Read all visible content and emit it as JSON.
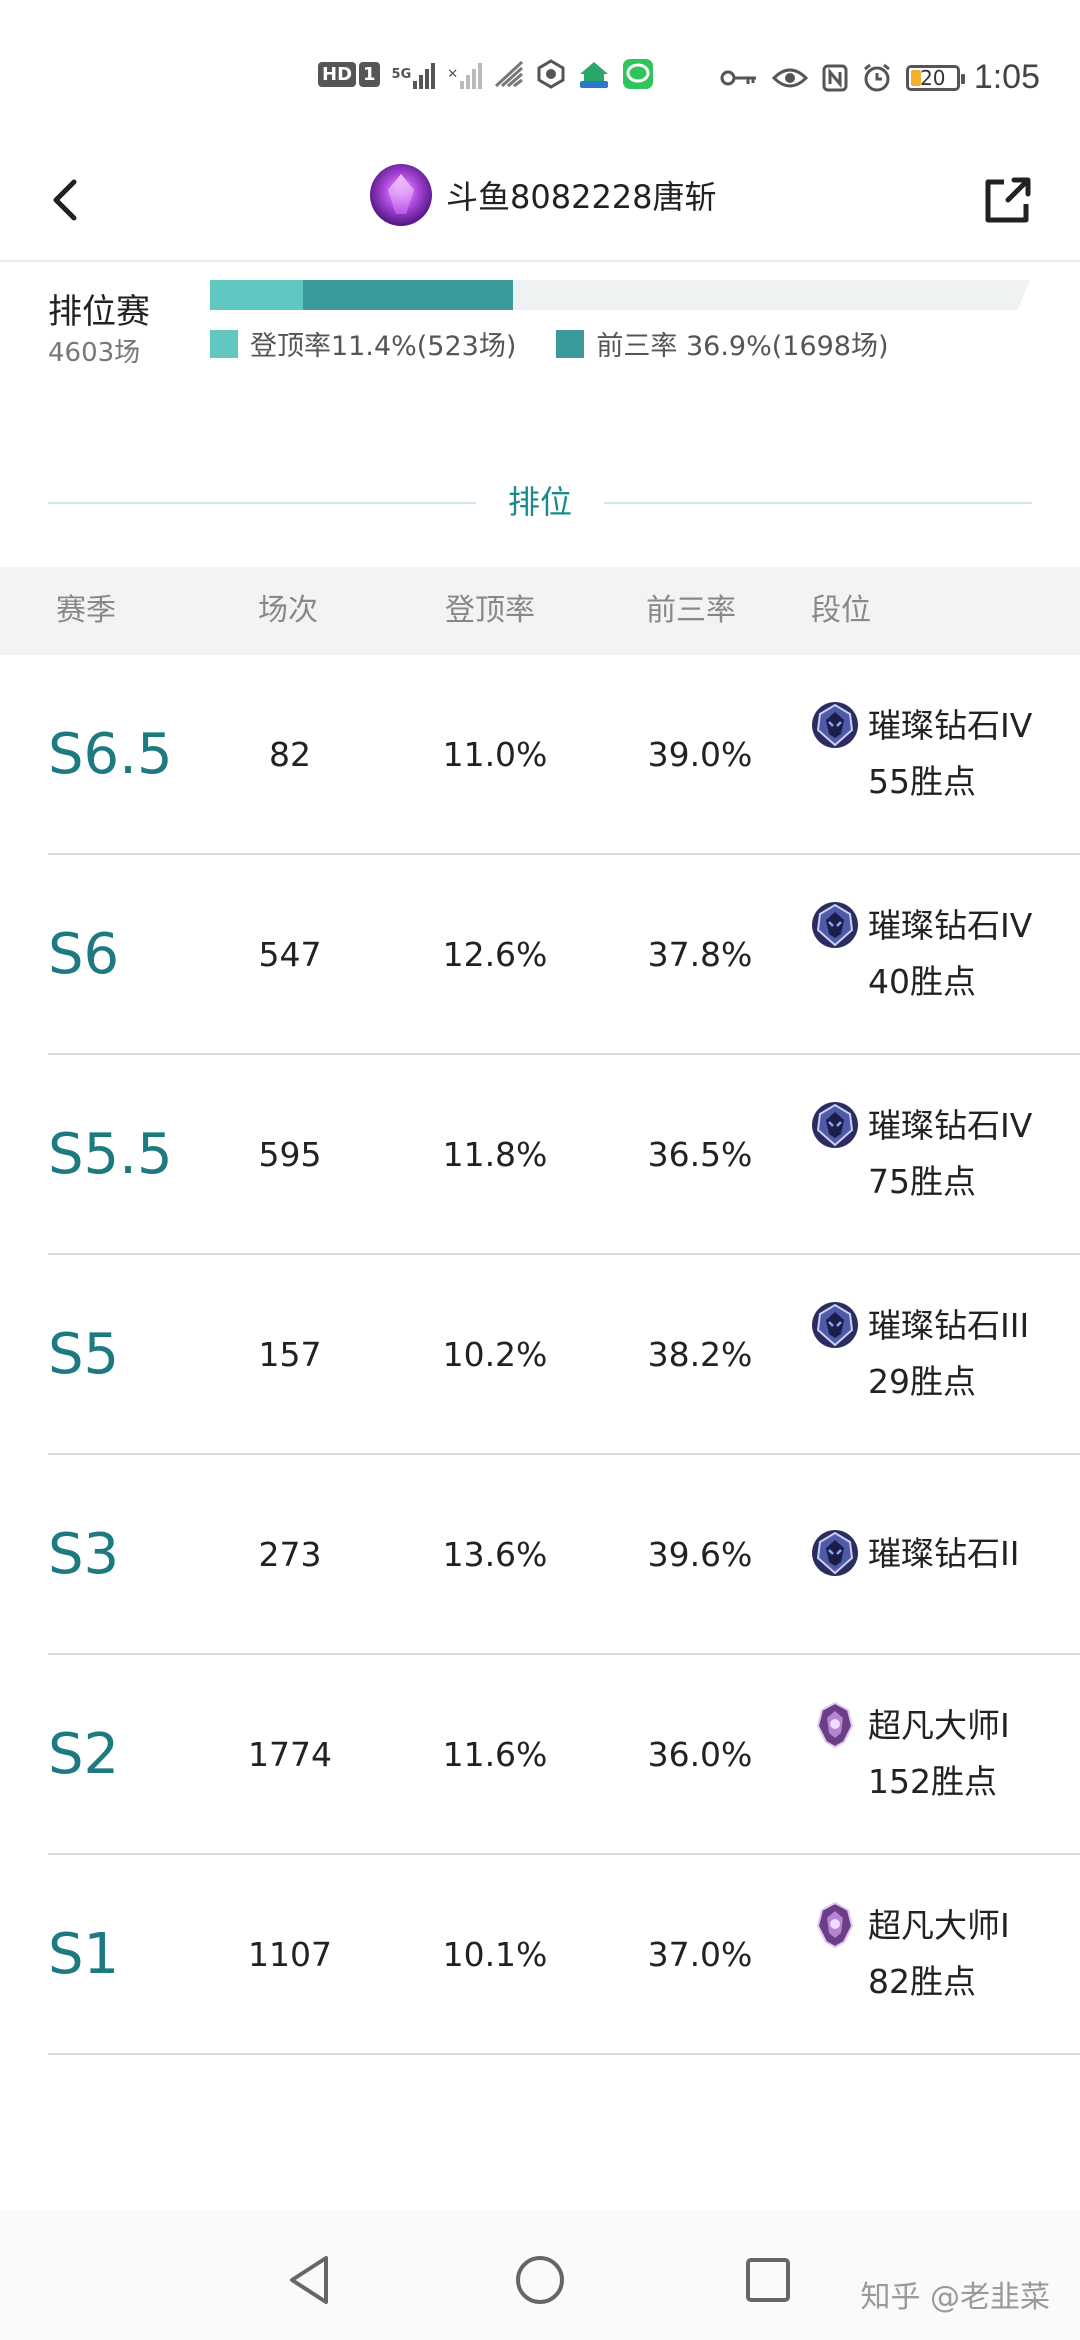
{
  "status_bar": {
    "network_hd": "HD",
    "sim_slot": "1",
    "net_type": "5G",
    "battery": "20",
    "time": "1:05",
    "icons": [
      "hd-icon",
      "signal-5g-icon",
      "signal-empty-icon",
      "wifi-icon",
      "hexagon-app-icon",
      "home-app-icon",
      "chat-app-icon",
      "key-icon",
      "eye-icon",
      "nfc-icon",
      "alarm-icon",
      "battery-icon"
    ]
  },
  "header": {
    "title": "斗鱼8082228唐斩"
  },
  "summary": {
    "label": "排位赛",
    "count": "4603场",
    "top1_rate": 11.4,
    "top3_rate": 36.9,
    "top1_legend": "登顶率11.4%(523场)",
    "top3_legend": "前三率 36.9%(1698场)",
    "top1_color": "#5fc6c0",
    "top3_color": "#3b9a9c"
  },
  "section": {
    "title": "排位"
  },
  "table": {
    "headers": {
      "season": "赛季",
      "games": "场次",
      "top1": "登顶率",
      "top3": "前三率",
      "rank": "段位"
    },
    "rows": [
      {
        "season": "S6.5",
        "games": "82",
        "top1": "11.0%",
        "top3": "39.0%",
        "rank": "璀璨钻石IV",
        "points": "55胜点",
        "icon": "diamond-rank-icon"
      },
      {
        "season": "S6",
        "games": "547",
        "top1": "12.6%",
        "top3": "37.8%",
        "rank": "璀璨钻石IV",
        "points": "40胜点",
        "icon": "diamond-rank-icon"
      },
      {
        "season": "S5.5",
        "games": "595",
        "top1": "11.8%",
        "top3": "36.5%",
        "rank": "璀璨钻石IV",
        "points": "75胜点",
        "icon": "diamond-rank-icon"
      },
      {
        "season": "S5",
        "games": "157",
        "top1": "10.2%",
        "top3": "38.2%",
        "rank": "璀璨钻石III",
        "points": "29胜点",
        "icon": "diamond-rank-icon"
      },
      {
        "season": "S3",
        "games": "273",
        "top1": "13.6%",
        "top3": "39.6%",
        "rank": "璀璨钻石II",
        "points": "",
        "icon": "diamond-rank-icon"
      },
      {
        "season": "S2",
        "games": "1774",
        "top1": "11.6%",
        "top3": "36.0%",
        "rank": "超凡大师I",
        "points": "152胜点",
        "icon": "master-rank-icon"
      },
      {
        "season": "S1",
        "games": "1107",
        "top1": "10.1%",
        "top3": "37.0%",
        "rank": "超凡大师I",
        "points": "82胜点",
        "icon": "master-rank-icon"
      }
    ]
  },
  "watermark": "知乎 @老韭菜"
}
